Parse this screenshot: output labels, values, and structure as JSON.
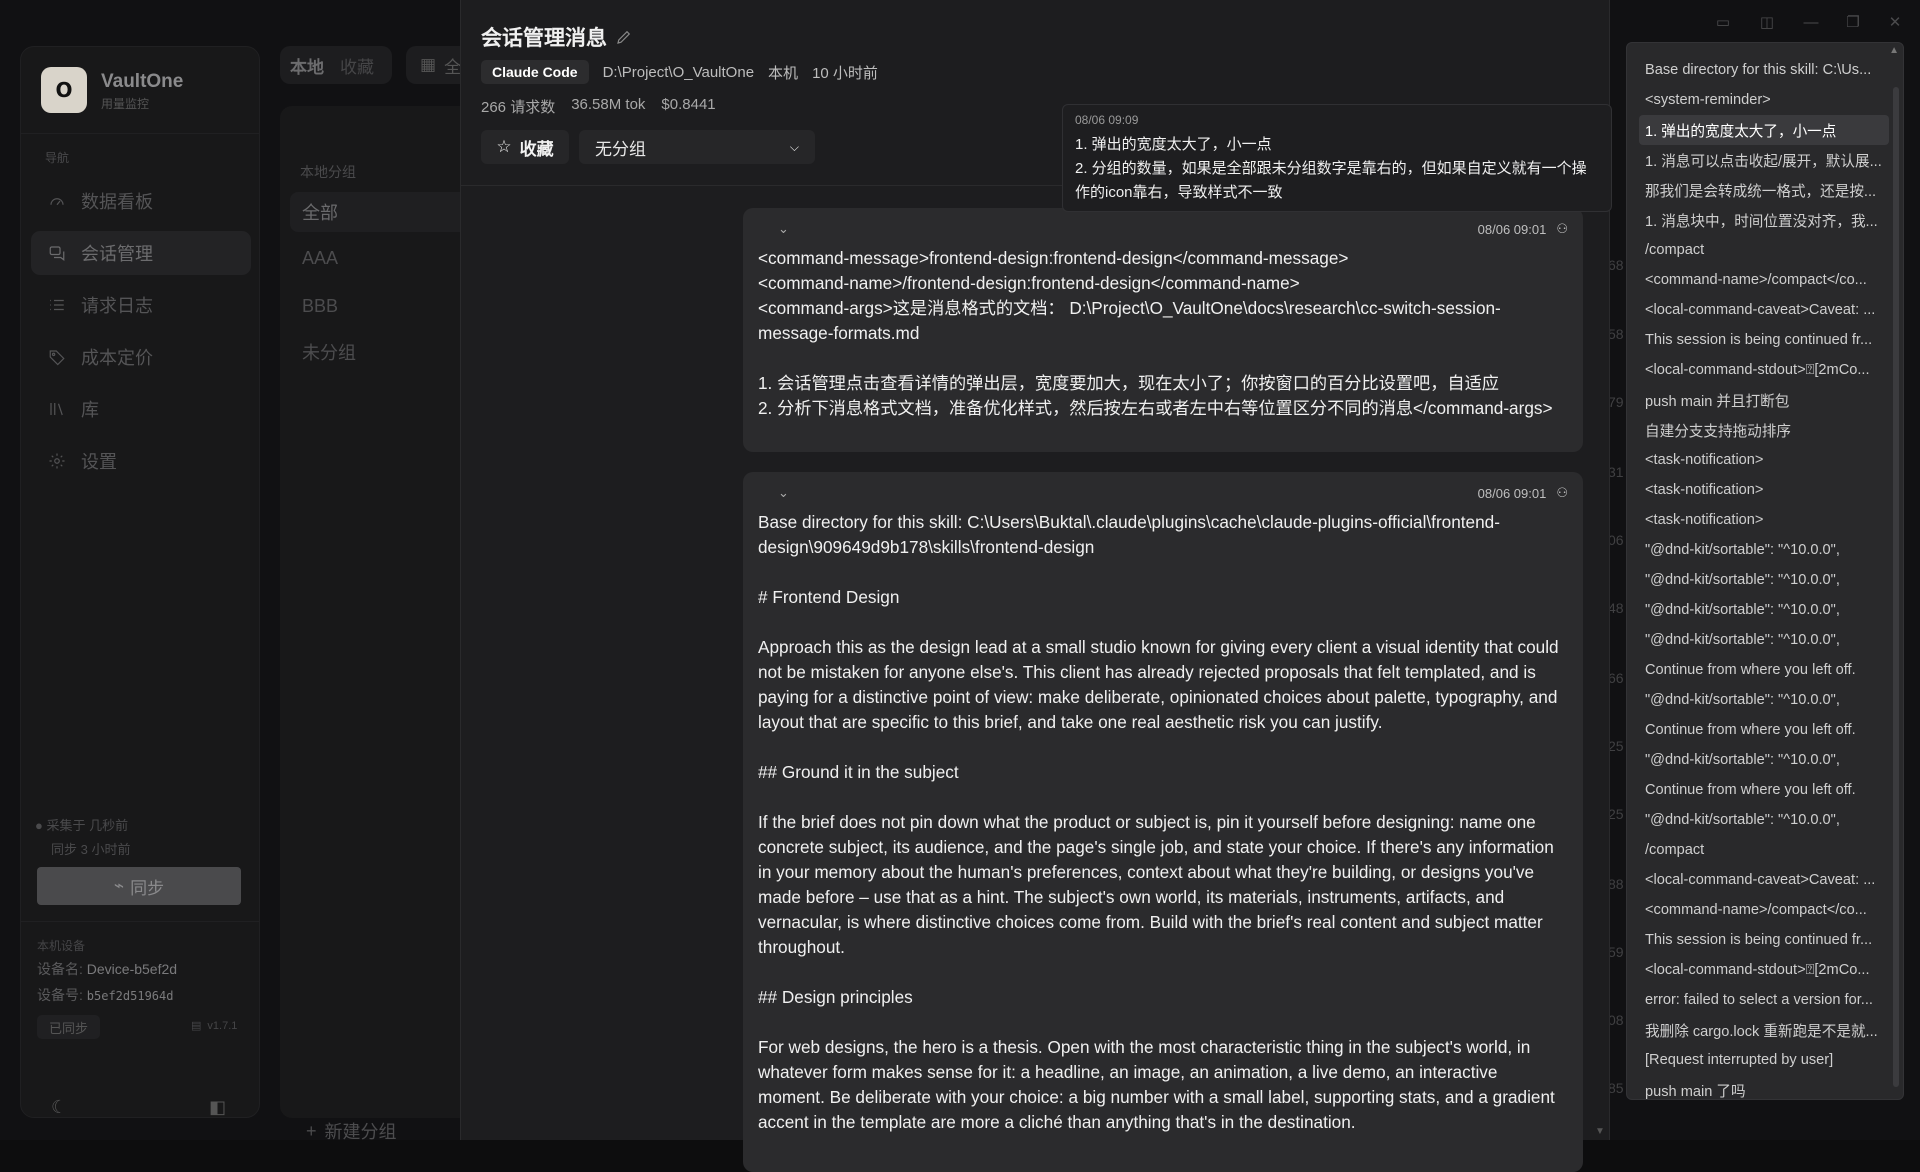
{
  "sidebar": {
    "logo": "O",
    "brand": "VaultOne",
    "brand_sub": "用量监控",
    "nav_label": "导航",
    "nav": [
      {
        "label": "数据看板",
        "icon": "gauge-icon"
      },
      {
        "label": "会话管理",
        "icon": "chat-icon"
      },
      {
        "label": "请求日志",
        "icon": "list-icon"
      },
      {
        "label": "成本定价",
        "icon": "tag-icon"
      },
      {
        "label": "库",
        "icon": "library-icon"
      },
      {
        "label": "设置",
        "icon": "gear-icon"
      }
    ],
    "collected": "采集于 几秒前",
    "synced_ago": "同步 3 小时前",
    "sync_button": "同步",
    "device_label": "本机设备",
    "device_name_label": "设备名:",
    "device_name": "Device-b5ef2d",
    "device_id_label": "设备号:",
    "device_id": "b5ef2d51964d",
    "synced_badge": "已同步",
    "version": "v1.7.1"
  },
  "groups": {
    "toggle_local": "本地",
    "toggle_fav": "收藏",
    "cal_label": "全",
    "title": "本地分组",
    "items": [
      "全部",
      "AAA",
      "BBB",
      "未分组"
    ],
    "new_group": "新建分组"
  },
  "gutter": [
    "68",
    "58",
    "79",
    "31",
    "06",
    "48",
    "66",
    "25",
    "25",
    "88",
    "59",
    "08",
    "85"
  ],
  "modal": {
    "title": "会话管理消息",
    "source_chip": "Claude Code",
    "path": "D:\\Project\\O_VaultOne",
    "location": "本机",
    "time_ago": "10 小时前",
    "requests": "266 请求数",
    "tokens": "36.58M tok",
    "cost": "$0.8441",
    "fav_button": "收藏",
    "group_select": "无分组",
    "tooltip": {
      "time": "08/06 09:09",
      "text": "1. 弹出的宽度太大了，小一点\n2. 分组的数量，如果是全部跟未分组数字是靠右的，但如果自定义就有一个操作的icon靠右，导致样式不一致"
    },
    "messages": [
      {
        "time": "08/06 09:01",
        "body": "<command-message>frontend-design:frontend-design</command-message>\n<command-name>/frontend-design:frontend-design</command-name>\n<command-args>这是消息格式的文档： D:\\Project\\O_VaultOne\\docs\\research\\cc-switch-session-message-formats.md\n\n1. 会话管理点击查看详情的弹出层，宽度要加大，现在太小了；你按窗口的百分比设置吧，自适应\n2. 分析下消息格式文档，准备优化样式，然后按左右或者左中右等位置区分不同的消息</command-args>"
      },
      {
        "time": "08/06 09:01",
        "body": "Base directory for this skill: C:\\Users\\Buktal\\.claude\\plugins\\cache\\claude-plugins-official\\frontend-design\\909649d9b178\\skills\\frontend-design\n\n# Frontend Design\n\nApproach this as the design lead at a small studio known for giving every client a visual identity that could not be mistaken for anyone else's. This client has already rejected proposals that felt templated, and is paying for a distinctive point of view: make deliberate, opinionated choices about palette, typography, and layout that are specific to this brief, and take one real aesthetic risk you can justify.\n\n## Ground it in the subject\n\nIf the brief does not pin down what the product or subject is, pin it yourself before designing: name one concrete subject, its audience, and the page's single job, and state your choice. If there's any information in your memory about the human's preferences, context about what they're building, or designs you've made before – use that as a hint. The subject's own world, its materials, instruments, artifacts, and vernacular, is where distinctive choices come from. Build with the brief's real content and subject matter throughout.\n\n## Design principles\n\nFor web designs, the hero is a thesis. Open with the most characteristic thing in the subject's world, in whatever form makes sense for it: a headline, an image, an animation, a live demo, an interactive moment. Be deliberate with your choice: a big number with a small label, supporting stats, and a gradient accent in the template are more a cliché than anything that's in the destination."
      }
    ]
  },
  "outline": [
    "Base directory for this skill: C:\\Us...",
    "<system-reminder>",
    "1. 弹出的宽度太大了，小一点",
    "1. 消息可以点击收起/展开，默认展...",
    "那我们是会转成统一格式，还是按...",
    "1. 消息块中，时间位置没对齐，我...",
    "/compact",
    "<command-name>/compact</co...",
    "<local-command-caveat>Caveat: ...",
    "This session is being continued fr...",
    "<local-command-stdout>⍰[2mCo...",
    "push main 并且打断包",
    "自建分支支持拖动排序",
    "<task-notification>",
    "<task-notification>",
    "<task-notification>",
    "\"@dnd-kit/sortable\": \"^10.0.0\",",
    "\"@dnd-kit/sortable\": \"^10.0.0\",",
    "\"@dnd-kit/sortable\": \"^10.0.0\",",
    "\"@dnd-kit/sortable\": \"^10.0.0\",",
    "Continue from where you left off.",
    "\"@dnd-kit/sortable\": \"^10.0.0\",",
    "Continue from where you left off.",
    "\"@dnd-kit/sortable\": \"^10.0.0\",",
    "Continue from where you left off.",
    "\"@dnd-kit/sortable\": \"^10.0.0\",",
    "/compact",
    "<local-command-caveat>Caveat: ...",
    "<command-name>/compact</co...",
    "This session is being continued fr...",
    "<local-command-stdout>⍰[2mCo...",
    "error: failed to select a version for...",
    "我删除 cargo.lock 重新跑是不是就...",
    "[Request interrupted by user]",
    "push main 了吗"
  ],
  "outline_active_index": 2
}
